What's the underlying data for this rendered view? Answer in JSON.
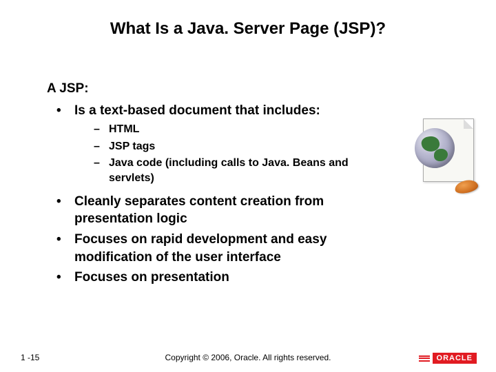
{
  "title": "What Is a Java. Server Page (JSP)?",
  "intro": "A JSP:",
  "bullets": [
    {
      "text": "Is a text-based document that includes:",
      "sub": [
        "HTML",
        "JSP tags",
        "Java code (including calls to Java. Beans and servlets)"
      ]
    },
    {
      "text": "Cleanly separates content creation from presentation logic"
    },
    {
      "text": "Focuses on rapid development and easy modification of the user interface"
    },
    {
      "text": "Focuses on presentation"
    }
  ],
  "footer": {
    "page": "1 -15",
    "copyright": "Copyright © 2006, Oracle. All rights reserved.",
    "logo": "ORACLE"
  }
}
